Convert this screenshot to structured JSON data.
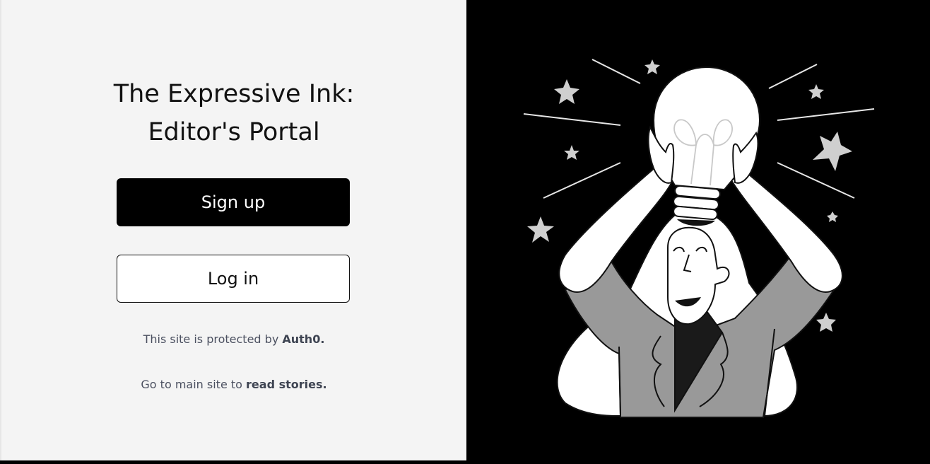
{
  "page": {
    "title_line1": "The Expressive Ink:",
    "title_line2": "Editor's Portal"
  },
  "buttons": {
    "signup_label": "Sign up",
    "login_label": "Log in"
  },
  "footer": {
    "protected_text": "This site is protected by ",
    "protected_link": "Auth0.",
    "main_site_text": "Go to main site to ",
    "main_site_link": "read stories."
  },
  "illustration": {
    "icon": "person-holding-lightbulb-illustration"
  },
  "colors": {
    "left_bg": "#f4f4f4",
    "right_bg": "#000000",
    "primary_button": "#000000",
    "accent_gray": "#999999",
    "star_gray": "#cccccc"
  }
}
